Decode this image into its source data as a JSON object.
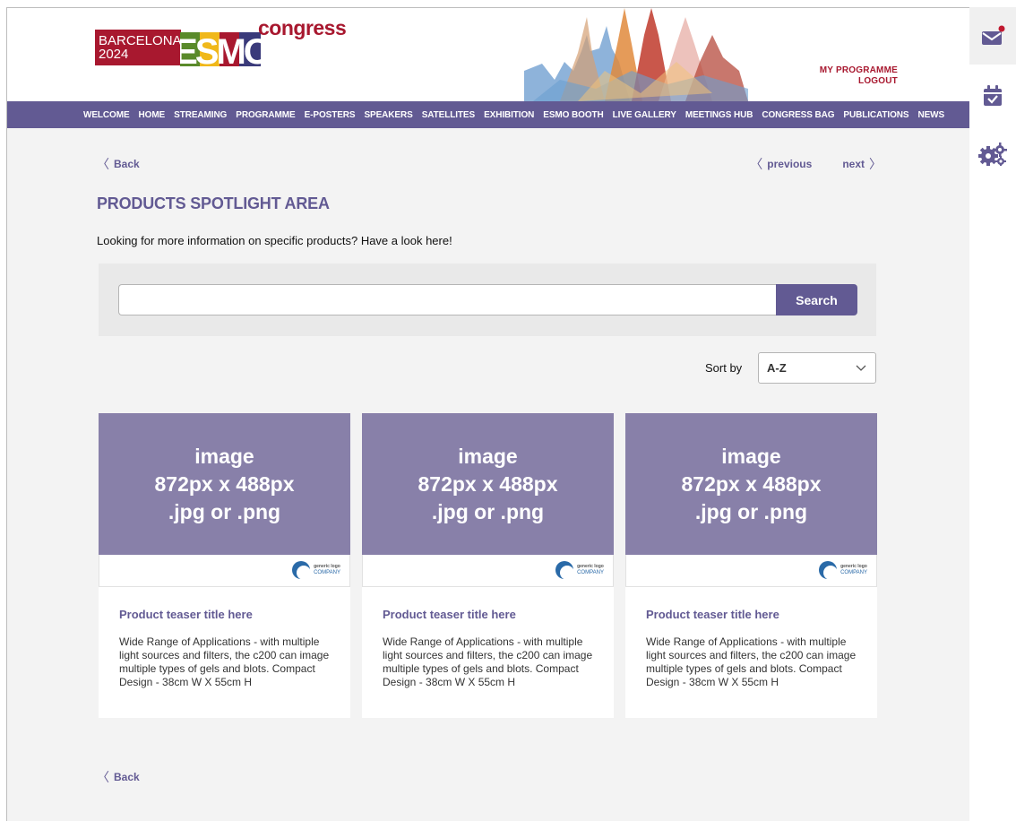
{
  "header": {
    "logo": {
      "line1": "BARCELONA",
      "line2": "2024",
      "brand": "ESMO",
      "suffix": "congress"
    },
    "links": {
      "my_programme": "MY PROGRAMME",
      "logout": "LOGOUT"
    }
  },
  "nav": {
    "items": [
      "WELCOME",
      "HOME",
      "STREAMING",
      "PROGRAMME",
      "E-POSTERS",
      "SPEAKERS",
      "SATELLITES",
      "EXHIBITION",
      "ESMO BOOTH",
      "LIVE GALLERY",
      "MEETINGS HUB",
      "CONGRESS BAG",
      "PUBLICATIONS",
      "NEWS"
    ]
  },
  "page": {
    "back": "Back",
    "previous": "previous",
    "next": "next",
    "title": "PRODUCTS SPOTLIGHT AREA",
    "intro": "Looking for more information on specific products? Have a look here!"
  },
  "search": {
    "value": "",
    "placeholder": "",
    "button": "Search"
  },
  "sort": {
    "label": "Sort by",
    "selected": "A-Z"
  },
  "cards": [
    {
      "image_lines": [
        "image",
        "872px x 488px",
        ".jpg or .png"
      ],
      "logo_small": "generic logo",
      "logo_big": "COMPANY",
      "title": "Product teaser title here",
      "desc": "Wide Range of Applications - with multiple light sources and filters, the c200 can image multiple types of gels and blots. Compact Design - 38cm W X 55cm H"
    },
    {
      "image_lines": [
        "image",
        "872px x 488px",
        ".jpg or .png"
      ],
      "logo_small": "generic logo",
      "logo_big": "COMPANY",
      "title": "Product teaser title here",
      "desc": "Wide Range of Applications - with multiple light sources and filters, the c200 can image multiple types of gels and blots. Compact Design - 38cm W X 55cm H"
    },
    {
      "image_lines": [
        "image",
        "872px x 488px",
        ".jpg or .png"
      ],
      "logo_small": "generic logo",
      "logo_big": "COMPANY",
      "title": "Product teaser title here",
      "desc": "Wide Range of Applications - with multiple light sources and filters, the c200 can image multiple types of gels and blots. Compact Design - 38cm W X 55cm H"
    }
  ],
  "sidebar": {
    "icons": [
      "mail-icon",
      "calendar-check-icon",
      "gears-icon"
    ],
    "mail_unread": true
  },
  "colors": {
    "brand_purple": "#625a93",
    "brand_red": "#a8182f",
    "card_image": "#8880a9"
  }
}
